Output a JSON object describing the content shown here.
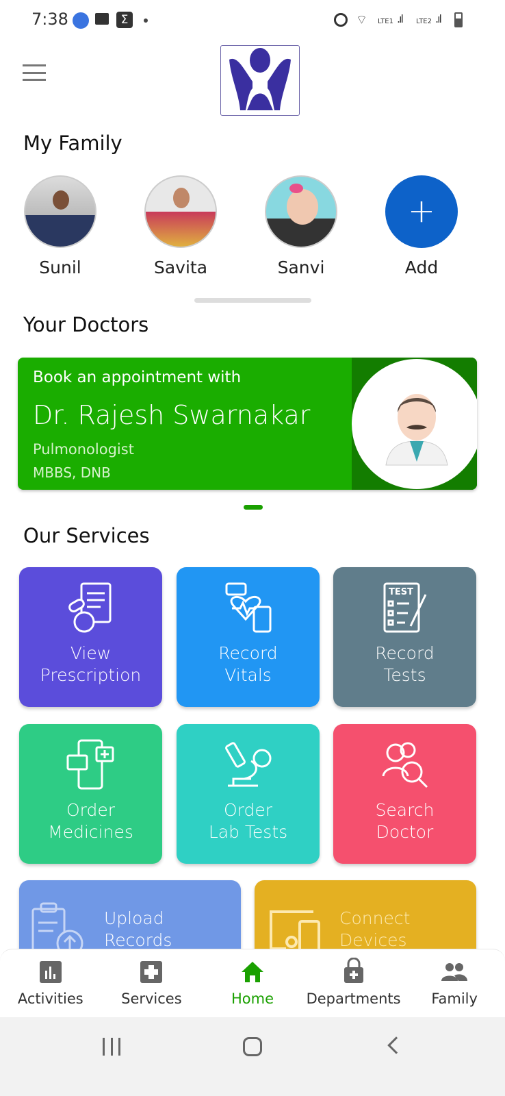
{
  "status_bar": {
    "time": "7:38",
    "network_labels": [
      "LTE1",
      "LTE2"
    ]
  },
  "header": {
    "menu_icon": "hamburger-icon",
    "logo": "hospital-logo"
  },
  "family": {
    "title": "My Family",
    "members": [
      {
        "name": "Sunil"
      },
      {
        "name": "Savita"
      },
      {
        "name": "Sanvi"
      }
    ],
    "add_label": "Add"
  },
  "doctors": {
    "title": "Your Doctors",
    "card": {
      "intro": "Book an appointment with",
      "name": "Dr. Rajesh Swarnakar",
      "specialty": "Pulmonologist",
      "degrees": "MBBS, DNB"
    }
  },
  "services": {
    "title": "Our Services",
    "tiles": [
      {
        "line1": "View",
        "line2": "Prescription",
        "color": "#5b4ddb",
        "icon": "prescription-icon"
      },
      {
        "line1": "Record",
        "line2": "Vitals",
        "color": "#2196f3",
        "icon": "vitals-icon"
      },
      {
        "line1": "Record",
        "line2": "Tests",
        "color": "#607d8b",
        "icon": "test-clipboard-icon"
      },
      {
        "line1": "Order",
        "line2": "Medicines",
        "color": "#2ecc85",
        "icon": "phone-medicine-icon"
      },
      {
        "line1": "Order",
        "line2": "Lab Tests",
        "color": "#2fd0c4",
        "icon": "microscope-icon"
      },
      {
        "line1": "Search",
        "line2": "Doctor",
        "color": "#f5506e",
        "icon": "search-doctor-icon"
      },
      {
        "line1": "Upload",
        "line2": "Records",
        "color": "#7098e6",
        "icon": "upload-records-icon"
      },
      {
        "line1": "Connect",
        "line2": "Devices",
        "color": "#e4b022",
        "icon": "devices-icon"
      }
    ]
  },
  "bottom_nav": {
    "active": "Home",
    "accent": "#1aa000",
    "items": [
      {
        "label": "Activities",
        "icon": "chart-icon"
      },
      {
        "label": "Services",
        "icon": "medical-cross-icon"
      },
      {
        "label": "Home",
        "icon": "home-icon"
      },
      {
        "label": "Departments",
        "icon": "lock-plus-icon"
      },
      {
        "label": "Family",
        "icon": "people-icon"
      }
    ]
  }
}
